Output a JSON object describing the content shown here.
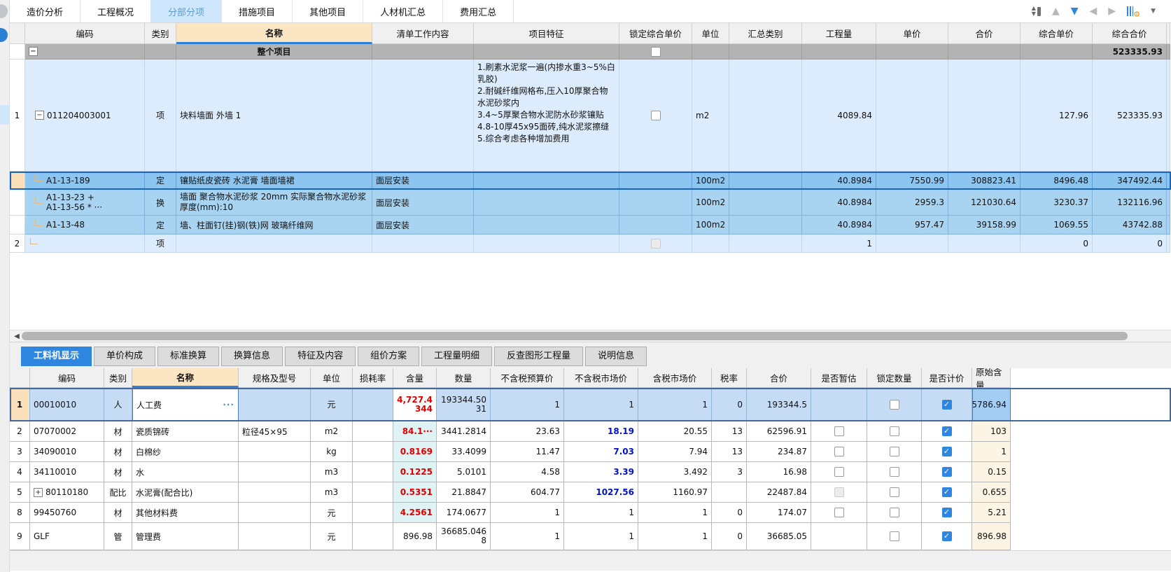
{
  "colors": {
    "accent": "#2e86e0",
    "selected_row": "#8cc5f0",
    "red_value": "#e00000",
    "blue_value": "#0012d0",
    "name_header": "#fbe5c3",
    "project_row": "#b3b3b3"
  },
  "top_tabs": {
    "items": [
      {
        "label": "造价分析",
        "active": false
      },
      {
        "label": "工程概况",
        "active": false
      },
      {
        "label": "分部分项",
        "active": true
      },
      {
        "label": "措施项目",
        "active": false
      },
      {
        "label": "其他项目",
        "active": false
      },
      {
        "label": "人材机汇总",
        "active": false
      },
      {
        "label": "费用汇总",
        "active": false
      }
    ]
  },
  "toolbar": {
    "icons": [
      "collapse-expand",
      "move-up",
      "move-down",
      "move-left",
      "move-right",
      "display-settings"
    ],
    "up_glyph": "▲",
    "down_glyph": "▼",
    "left_glyph": "◀",
    "right_glyph": "▶",
    "gear_glyph": "⚙",
    "caret_glyph": "▼"
  },
  "top_table": {
    "headers": [
      "编码",
      "类别",
      "名称",
      "清单工作内容",
      "项目特征",
      "锁定综合单价",
      "单位",
      "汇总类别",
      "工程量",
      "单价",
      "合价",
      "综合单价",
      "综合合价"
    ],
    "project_row": {
      "collapse": "−",
      "name": "整个项目",
      "lock": "unchecked",
      "comp_total": "523335.93"
    },
    "rows": [
      {
        "num": "1",
        "collapse": "−",
        "code": "011204003001",
        "cat": "项",
        "name": "块料墙面 外墙 1",
        "feature": "1.刷素水泥浆一遍(内掺水重3~5%白乳胶)\n2.耐碱纤维网格布,压入10厚聚合物水泥砂浆内\n3.4~5厚聚合物水泥防水砂浆镶贴\n4.8-10厚45x95面砖,纯水泥浆擦缝\n5.综合考虑各种增加费用",
        "lock": "unchecked",
        "unit": "m2",
        "qty": "4089.84",
        "comp_price": "127.96",
        "comp_total": "523335.93"
      },
      {
        "code": "A1-13-189",
        "cat": "定",
        "name": "镶贴纸皮瓷砖 水泥膏 墙面墙裙",
        "work": "面层安装",
        "unit": "100m2",
        "qty": "40.8984",
        "price": "7550.99",
        "total": "308823.41",
        "comp_price": "8496.48",
        "comp_total": "347492.44"
      },
      {
        "code": "A1-13-23 +\nA1-13-56 * ···",
        "cat": "换",
        "name": "墙面 聚合物水泥砂浆 20mm  实际聚合物水泥砂浆厚度(mm):10",
        "work": "面层安装",
        "unit": "100m2",
        "qty": "40.8984",
        "price": "2959.3",
        "total": "121030.64",
        "comp_price": "3230.37",
        "comp_total": "132116.96"
      },
      {
        "code": "A1-13-48",
        "cat": "定",
        "name": "墙、柱面钉(挂)钢(铁)网 玻璃纤维网",
        "work": "面层安装",
        "unit": "100m2",
        "qty": "40.8984",
        "price": "957.47",
        "total": "39158.99",
        "comp_price": "1069.55",
        "comp_total": "43742.88"
      },
      {
        "num": "2",
        "cat": "项",
        "lock": "disabled",
        "qty": "1",
        "comp_price": "0",
        "comp_total": "0"
      }
    ]
  },
  "bottom_tabs": {
    "items": [
      {
        "label": "工料机显示",
        "active": true
      },
      {
        "label": "单价构成",
        "active": false
      },
      {
        "label": "标准换算",
        "active": false
      },
      {
        "label": "换算信息",
        "active": false
      },
      {
        "label": "特征及内容",
        "active": false
      },
      {
        "label": "组价方案",
        "active": false
      },
      {
        "label": "工程量明细",
        "active": false
      },
      {
        "label": "反查图形工程量",
        "active": false
      },
      {
        "label": "说明信息",
        "active": false
      }
    ]
  },
  "bottom_table": {
    "headers": [
      "编码",
      "类别",
      "名称",
      "规格及型号",
      "单位",
      "损耗率",
      "含量",
      "数量",
      "不含税预算价",
      "不含税市场价",
      "含税市场价",
      "税率",
      "合价",
      "是否暂估",
      "锁定数量",
      "是否计价",
      "原始含量"
    ],
    "rows": [
      {
        "num": "1",
        "code": "00010010",
        "cat": "人",
        "name": "人工费",
        "more": "···",
        "spec": "",
        "unit": "元",
        "loss": "",
        "content": "4,727.4344",
        "qty": "193344.5031",
        "budget": "1",
        "market": "1",
        "taxmarket": "1",
        "taxrate": "0",
        "total": "193344.5",
        "est": "none",
        "lockqty": "unchecked",
        "priced": "checked",
        "orig": "5786.94"
      },
      {
        "num": "2",
        "code": "07070002",
        "cat": "材",
        "name": "瓷质锦砖",
        "spec": "粒径45×95",
        "unit": "m2",
        "loss": "",
        "content": "84.1···",
        "qty": "3441.2814",
        "budget": "23.63",
        "market": "18.19",
        "taxmarket": "20.55",
        "taxrate": "13",
        "total": "62596.91",
        "est": "unchecked",
        "lockqty": "unchecked",
        "priced": "checked",
        "orig": "103"
      },
      {
        "num": "3",
        "code": "34090010",
        "cat": "材",
        "name": "白棉纱",
        "spec": "",
        "unit": "kg",
        "loss": "",
        "content": "0.8169",
        "qty": "33.4099",
        "budget": "11.47",
        "market": "7.03",
        "taxmarket": "7.94",
        "taxrate": "13",
        "total": "234.87",
        "est": "unchecked",
        "lockqty": "unchecked",
        "priced": "checked",
        "orig": "1"
      },
      {
        "num": "4",
        "code": "34110010",
        "cat": "材",
        "name": "水",
        "spec": "",
        "unit": "m3",
        "loss": "",
        "content": "0.1225",
        "qty": "5.0101",
        "budget": "4.58",
        "market": "3.39",
        "taxmarket": "3.492",
        "taxrate": "3",
        "total": "16.98",
        "est": "unchecked",
        "lockqty": "unchecked",
        "priced": "checked",
        "orig": "0.15"
      },
      {
        "num": "5",
        "expand": "+",
        "code": "80110180",
        "cat": "配比",
        "name": "水泥膏(配合比)",
        "spec": "",
        "unit": "m3",
        "loss": "",
        "content": "0.5351",
        "qty": "21.8847",
        "budget": "604.77",
        "market": "1027.56",
        "taxmarket": "1160.97",
        "taxrate": "",
        "total": "22487.84",
        "est": "disabled",
        "lockqty": "unchecked",
        "priced": "checked",
        "orig": "0.655"
      },
      {
        "num": "8",
        "code": "99450760",
        "cat": "材",
        "name": "其他材料费",
        "spec": "",
        "unit": "元",
        "loss": "",
        "content": "4.2561",
        "qty": "174.0677",
        "budget": "1",
        "market": "1",
        "taxmarket": "1",
        "taxrate": "0",
        "total": "174.07",
        "est": "unchecked",
        "lockqty": "unchecked",
        "priced": "checked",
        "orig": "5.21"
      },
      {
        "num": "9",
        "code": "GLF",
        "cat": "管",
        "name": "管理费",
        "spec": "",
        "unit": "元",
        "loss": "",
        "content": "896.98",
        "qty": "36685.0468",
        "budget": "1",
        "market": "1",
        "taxmarket": "1",
        "taxrate": "0",
        "total": "36685.05",
        "est": "none",
        "lockqty": "unchecked",
        "priced": "checked",
        "orig": "896.98"
      }
    ]
  }
}
